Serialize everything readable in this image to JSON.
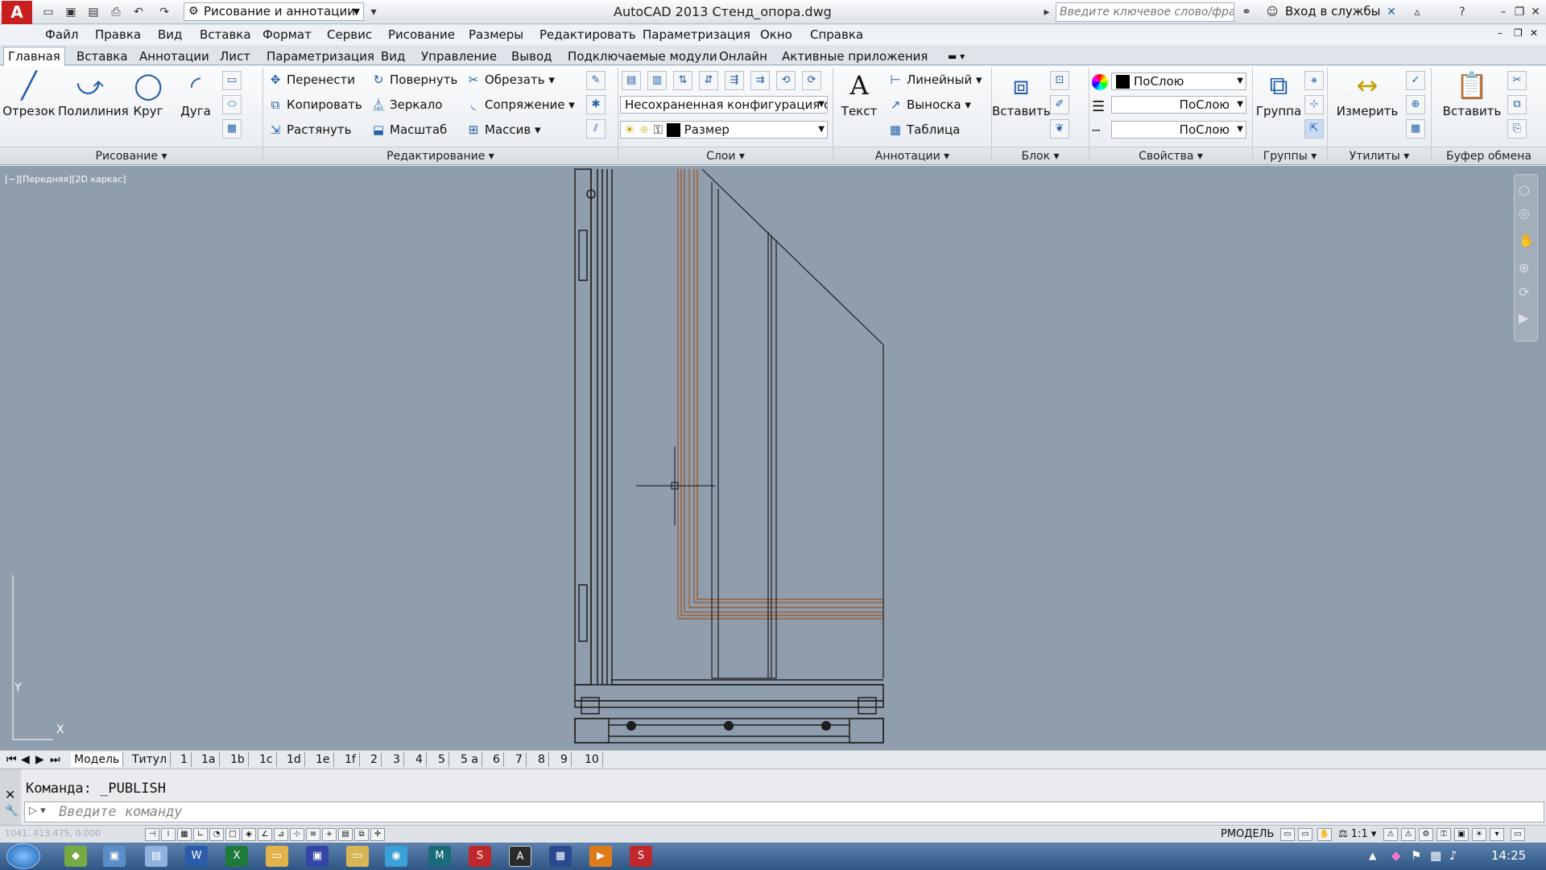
{
  "titlebar": {
    "logo": "A",
    "workspace": "Рисование и аннотации",
    "title": "AutoCAD 2013    Стенд_опора.dwg",
    "search_placeholder": "Введите ключевое слово/фразу",
    "login": "Вход в службы"
  },
  "menu": [
    "Файл",
    "Правка",
    "Вид",
    "Вставка",
    "Формат",
    "Сервис",
    "Рисование",
    "Размеры",
    "Редактировать",
    "Параметризация",
    "Окно",
    "Справка"
  ],
  "tabs": [
    "Главная",
    "Вставка",
    "Аннотации",
    "Лист",
    "Параметризация",
    "Вид",
    "Управление",
    "Вывод",
    "Подключаемые модули",
    "Онлайн",
    "Активные приложения"
  ],
  "ribbon": {
    "draw": {
      "title": "Рисование",
      "line": "Отрезок",
      "polyline": "Полилиния",
      "circle": "Круг",
      "arc": "Дуга"
    },
    "modify": {
      "title": "Редактирование",
      "move": "Перенести",
      "copy": "Копировать",
      "stretch": "Растянуть",
      "rotate": "Повернуть",
      "mirror": "Зеркало",
      "scale": "Масштаб",
      "trim": "Обрезать",
      "fillet": "Сопряжение",
      "array": "Массив"
    },
    "layers": {
      "title": "Слои",
      "state": "Несохраненная конфигурация сло",
      "current": "Размер"
    },
    "annotation": {
      "title": "Аннотации",
      "text": "Текст",
      "linear": "Линейный",
      "leader": "Выноска",
      "table": "Таблица"
    },
    "block": {
      "title": "Блок",
      "insert": "Вставить"
    },
    "properties": {
      "title": "Свойства",
      "color": "ПоСлою",
      "linetype": "ПоСлою",
      "lineweight": "ПоСлою"
    },
    "groups": {
      "title": "Группы",
      "group": "Группа"
    },
    "utilities": {
      "title": "Утилиты",
      "measure": "Измерить"
    },
    "clipboard": {
      "title": "Буфер обмена",
      "paste": "Вставить"
    }
  },
  "viewport": {
    "label": "[−][Передняя][2D каркас]",
    "ucs_y": "Y",
    "ucs_x": "X"
  },
  "layout_tabs": [
    "Модель",
    "Титул",
    "1",
    "1a",
    "1b",
    "1c",
    "1d",
    "1e",
    "1f",
    "2",
    "3",
    "4",
    "5",
    "5 a",
    "6",
    "7",
    "8",
    "9",
    "10"
  ],
  "command": {
    "history": "Команда:  _PUBLISH",
    "placeholder": "Введите команду"
  },
  "status": {
    "coords": "1041, 413.475, 0.000",
    "model": "РМОДЕЛЬ",
    "scale": "1:1"
  },
  "taskbar": {
    "clock": "14:25"
  },
  "colors": {
    "canvas": "#8f9dad",
    "accent": "#1f5aa6",
    "wood": "#a0521c",
    "logo": "#c81e1e"
  }
}
